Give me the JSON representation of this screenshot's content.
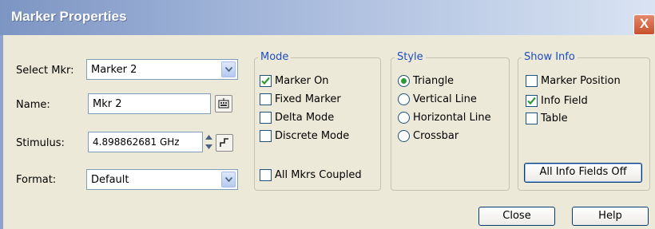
{
  "window": {
    "title": "Marker Properties",
    "close_glyph": "X"
  },
  "left": {
    "select_label": "Select Mkr:",
    "select_value": "Marker 2",
    "name_label": "Name:",
    "name_value": "Mkr 2",
    "stimulus_label": "Stimulus:",
    "stimulus_value": "4.898862681 GHz",
    "format_label": "Format:",
    "format_value": "Default"
  },
  "mode": {
    "title": "Mode",
    "items": [
      {
        "label": "Marker On",
        "checked": true
      },
      {
        "label": "Fixed Marker",
        "checked": false
      },
      {
        "label": "Delta Mode",
        "checked": false
      },
      {
        "label": "Discrete Mode",
        "checked": false
      }
    ],
    "coupled": {
      "label": "All Mkrs Coupled",
      "checked": false
    }
  },
  "style": {
    "title": "Style",
    "items": [
      {
        "label": "Triangle",
        "selected": true
      },
      {
        "label": "Vertical Line",
        "selected": false
      },
      {
        "label": "Horizontal Line",
        "selected": false
      },
      {
        "label": "Crossbar",
        "selected": false
      }
    ]
  },
  "show_info": {
    "title": "Show Info",
    "items": [
      {
        "label": "Marker Position",
        "checked": false
      },
      {
        "label": "Info Field",
        "checked": true
      },
      {
        "label": "Table",
        "checked": false
      }
    ],
    "button": "All Info Fields Off"
  },
  "footer": {
    "close": "Close",
    "help": "Help"
  },
  "colors": {
    "group_title": "#1d4dc0",
    "check_mark": "#2b9a35",
    "titlebar": "#7d95c3",
    "close": "#c9512c"
  }
}
